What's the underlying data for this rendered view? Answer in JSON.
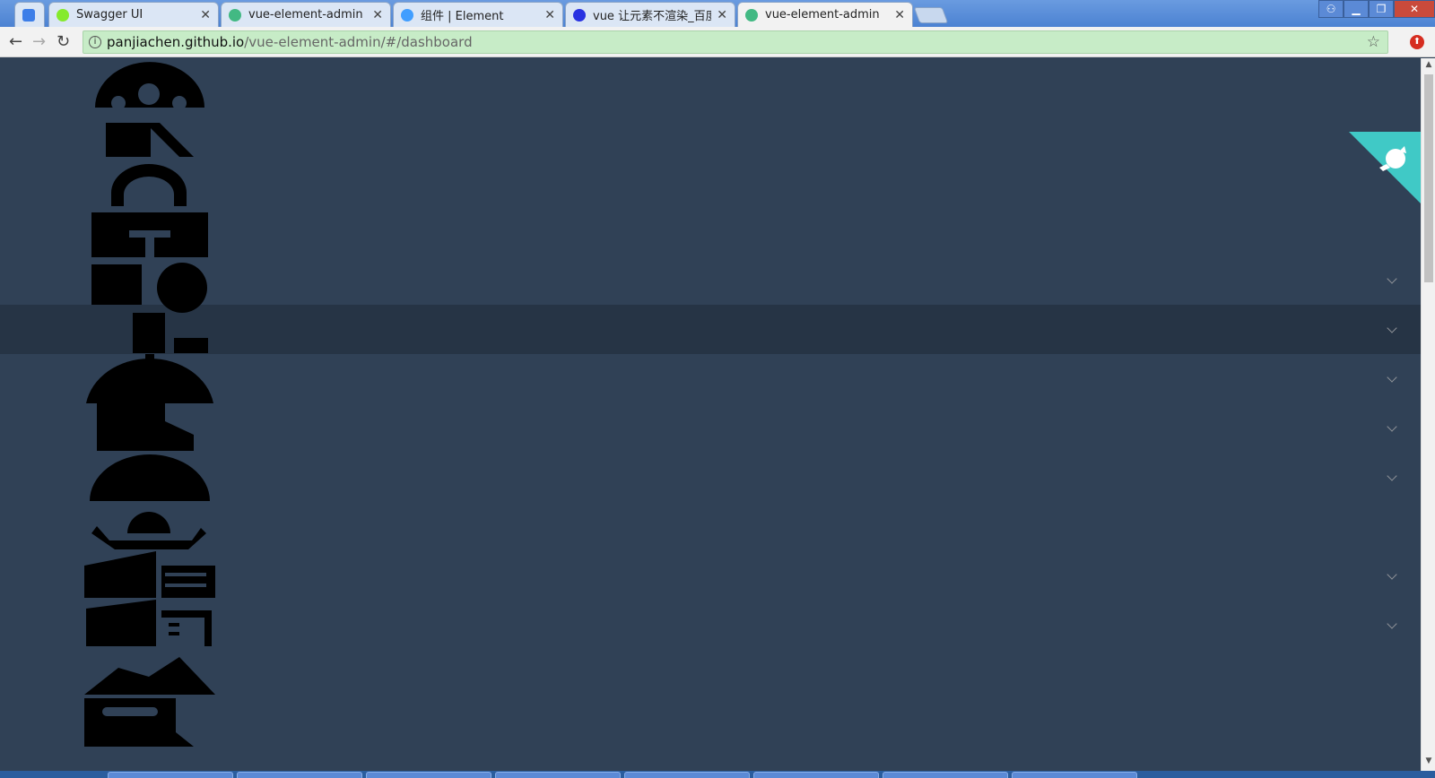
{
  "browser": {
    "tabs": [
      {
        "title": "",
        "favicon_color": "#3d7ee8",
        "closable": false
      },
      {
        "title": "Swagger UI",
        "favicon_color": "#85ea2d",
        "closable": true
      },
      {
        "title": "vue-element-admin",
        "favicon_color": "#42b983",
        "closable": true
      },
      {
        "title": "组件 | Element",
        "favicon_color": "#409eff",
        "closable": true
      },
      {
        "title": "vue 让元素不渲染_百度",
        "favicon_color": "#2932e1",
        "closable": true
      },
      {
        "title": "vue-element-admin",
        "favicon_color": "#42b983",
        "closable": true
      }
    ],
    "active_tab": 5,
    "address": {
      "host": "panjiachen.github.io",
      "path": "/vue-element-admin/#/dashboard"
    },
    "icons": {
      "back": "back-arrow-icon",
      "forward": "forward-arrow-icon",
      "reload": "reload-icon",
      "info": "info-icon",
      "star": "star-icon",
      "extension": "extension-icon"
    }
  },
  "sidebar": {
    "background": "#304156",
    "active_background": "#263445",
    "menu_items": [
      {
        "icon": "dashboard-icon",
        "expandable": true
      },
      {
        "icon": "permission-icon",
        "expandable": true,
        "active": true
      },
      {
        "icon": "components-icon",
        "expandable": true
      },
      {
        "icon": "charts-icon",
        "expandable": true
      },
      {
        "icon": "nested-icon",
        "expandable": true
      },
      {
        "icon": "table-icon",
        "expandable": false
      },
      {
        "icon": "example-icon",
        "expandable": true
      },
      {
        "icon": "tab-icon",
        "expandable": true
      }
    ]
  },
  "corner_badge": {
    "icon": "github-octocat-icon",
    "color": "#40c9c6"
  },
  "colors": {
    "chevron": "#909399",
    "icons": "#000000"
  }
}
